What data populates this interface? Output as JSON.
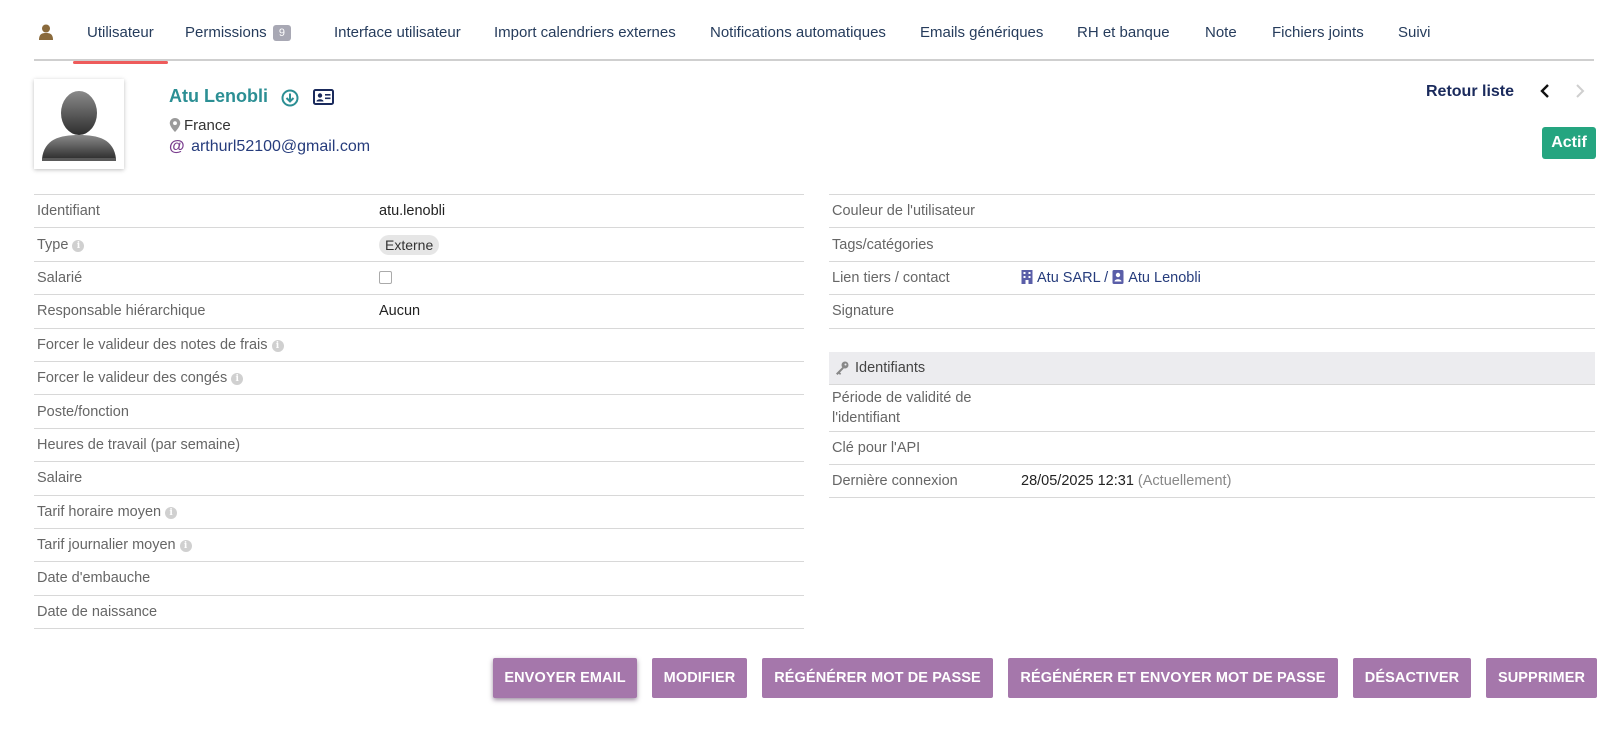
{
  "tabs": [
    {
      "label": "Utilisateur"
    },
    {
      "label": "Permissions",
      "badge": "9"
    },
    {
      "label": "Interface utilisateur"
    },
    {
      "label": "Import calendriers externes"
    },
    {
      "label": "Notifications automatiques"
    },
    {
      "label": "Emails génériques"
    },
    {
      "label": "RH et banque"
    },
    {
      "label": "Note"
    },
    {
      "label": "Fichiers joints"
    },
    {
      "label": "Suivi"
    }
  ],
  "header": {
    "name": "Atu Lenobli",
    "country": "France",
    "email_symbol": "@",
    "email": "arthurl52100@gmail.com",
    "back_label": "Retour liste",
    "status": "Actif"
  },
  "left_fields": [
    {
      "label": "Identifiant",
      "value": "atu.lenobli"
    },
    {
      "label": "Type",
      "value": "Externe"
    },
    {
      "label": "Salarié",
      "value": ""
    },
    {
      "label": "Responsable hiérarchique",
      "value": "Aucun"
    },
    {
      "label": "Forcer le valideur des notes de frais",
      "value": ""
    },
    {
      "label": "Forcer le valideur des congés",
      "value": ""
    },
    {
      "label": "Poste/fonction",
      "value": ""
    },
    {
      "label": "Heures de travail (par semaine)",
      "value": ""
    },
    {
      "label": "Salaire",
      "value": ""
    },
    {
      "label": "Tarif horaire moyen",
      "value": ""
    },
    {
      "label": "Tarif journalier moyen",
      "value": ""
    },
    {
      "label": "Date d'embauche",
      "value": ""
    },
    {
      "label": "Date de naissance",
      "value": ""
    }
  ],
  "right_fields": [
    {
      "label": "Couleur de l'utilisateur",
      "value": ""
    },
    {
      "label": "Tags/catégories",
      "value": ""
    },
    {
      "label": "Lien tiers / contact",
      "company": "Atu SARL",
      "separator": "/",
      "contact": "Atu Lenobli"
    },
    {
      "label": "Signature",
      "value": ""
    }
  ],
  "identifiants": {
    "title": "Identifiants",
    "fields": [
      {
        "label": "Période de validité de l'identifiant",
        "value": ""
      },
      {
        "label": "Clé pour l'API",
        "value": ""
      },
      {
        "label": "Dernière connexion",
        "value": "28/05/2025 12:31",
        "note": "(Actuellement)"
      }
    ]
  },
  "buttons": [
    {
      "label": "ENVOYER EMAIL"
    },
    {
      "label": "MODIFIER"
    },
    {
      "label": "RÉGÉNÉRER MOT DE PASSE"
    },
    {
      "label": "RÉGÉNÉRER ET ENVOYER MOT DE PASSE"
    },
    {
      "label": "DÉSACTIVER"
    },
    {
      "label": "SUPPRIMER"
    }
  ],
  "colors": {
    "accent": "#2c8f94",
    "active_tab_underline": "#ee5b5b",
    "status_green": "#25a580",
    "button_purple": "#a577ab"
  }
}
